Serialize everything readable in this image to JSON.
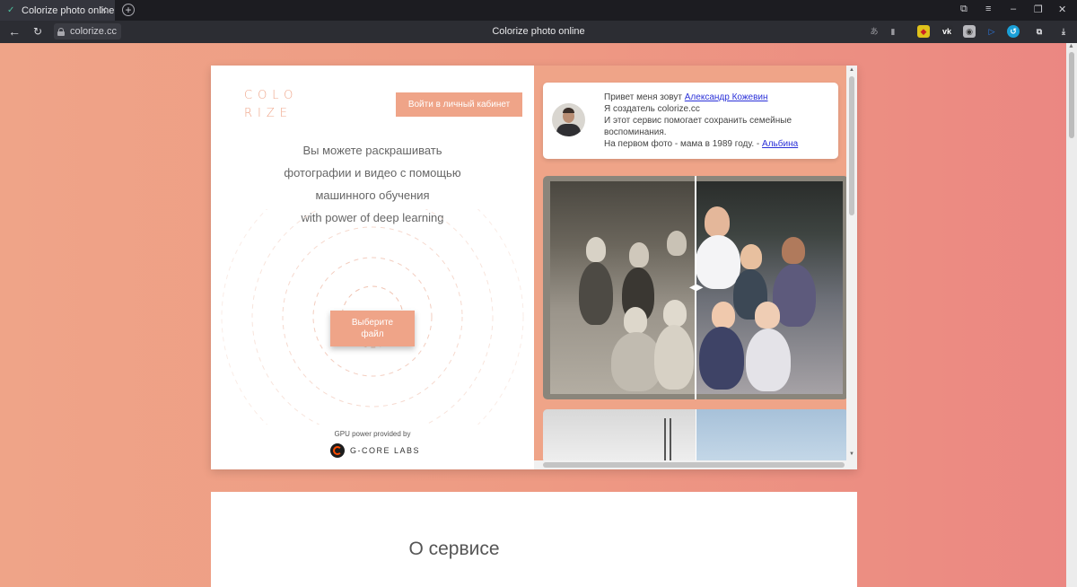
{
  "browser": {
    "tab_title": "Colorize photo online",
    "url": "colorize.cc",
    "window_title": "Colorize photo online"
  },
  "site": {
    "logo_line1": "COLO",
    "logo_line2": "RIZE",
    "login_button": "Войти в личный кабинет",
    "tagline": [
      "Вы можете раскрашивать",
      "фотографии и видео с помощью",
      "машинного обучения",
      "with power of deep learning"
    ],
    "choose_file_button_line1": "Выберите",
    "choose_file_button_line2": "файл",
    "gpu_text": "GPU power provided by",
    "gcore_text": "G-CORE LABS",
    "accent_color": "#efa488"
  },
  "intro": {
    "greeting": "Привет меня зовут ",
    "author_name": "Александр Кожевин",
    "line2": "Я создатель colorize.cc",
    "line3": "И этот сервис помогает сохранить семейные воспоминания.",
    "line4": "На первом фото - мама в 1989 году. - ",
    "mom_name": "Альбина"
  },
  "about": {
    "title": "О сервисе"
  }
}
